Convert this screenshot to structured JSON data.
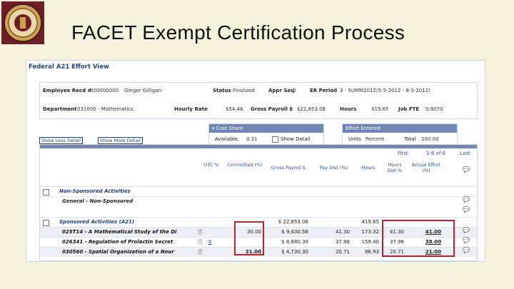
{
  "slide": {
    "title": "FACET Exempt Certification Process"
  },
  "view": {
    "title": "Federal A21 Effort View",
    "employee_label": "Employee Recd #",
    "employee_id": "000000000",
    "employee_name": "Ginger Gilligan",
    "status_label": "Status",
    "status_value": "Finalized",
    "appr_seq_label": "Appr Seq",
    "appr_seq_value": "0",
    "er_period_label": "ER Period",
    "er_period_value": "3 - SUMM2012(5-5-2012 - 8-3-2012)",
    "department_label": "Department",
    "department_value": "031000 - Mathematics",
    "hourly_rate_label": "Hourly Rate",
    "hourly_rate_value": "$54.46",
    "gross_payroll_label": "Gross Payroll $",
    "gross_payroll_value": "$22,853.06",
    "hours_label": "Hours",
    "hours_value": "419.65",
    "job_fte_label": "Job FTE",
    "job_fte_value": "0.9070"
  },
  "cost_share": {
    "header": "Cost Share",
    "available_label": "Available:",
    "available_value": "0.31",
    "show_detail": "Show Detail"
  },
  "effort_entered": {
    "header": "Effort Entered",
    "units_label": "Units",
    "units_value": "Percent",
    "total_label": "Total",
    "total_value": "100.00"
  },
  "buttons": {
    "show_less": "Show Less Detail",
    "show_more": "Show More Detail"
  },
  "pager": {
    "first": "First",
    "range": "1-6 of 6",
    "last": "Last"
  },
  "columns": {
    "otc": "OTC %",
    "committed": "Committed (%)",
    "gross_payroll": "Gross Payroll $",
    "pay_dist": "Pay Dist (%)",
    "hours": "Hours",
    "hours_dist": "Hours Dist %",
    "actual_effort": "Actual Effort (%)"
  },
  "sections": {
    "non_sponsored": {
      "title": "Non-Sponsored Activities",
      "general": "General - Non-Sponsored"
    },
    "sponsored": {
      "title": "Sponsored Activities (A21)",
      "gross_payroll": "$ 22,853.06",
      "hours": "419.65"
    }
  },
  "rows": [
    {
      "name": "025T14 - A Mathematical Study of the Di",
      "otc": "",
      "committed": "30.00",
      "gross_payroll": "$ 9,430.56",
      "pay_dist": "41.30",
      "hours": "173.32",
      "hours_dist": "41.30",
      "actual_effort": "41.00"
    },
    {
      "name": "026341 - Regulation of Prolactin Secret",
      "otc": "0",
      "committed": "",
      "gross_payroll": "$ 8,680.30",
      "pay_dist": "37.98",
      "hours": "159.40",
      "hours_dist": "37.98",
      "actual_effort": "38.00"
    },
    {
      "name": "030560 - Spatial Organization of a Neur",
      "otc": "",
      "committed": "21.00",
      "gross_payroll": "$ 4,730.30",
      "pay_dist": "20.71",
      "hours": "86.93",
      "hours_dist": "20.71",
      "actual_effort": "21.00"
    }
  ]
}
